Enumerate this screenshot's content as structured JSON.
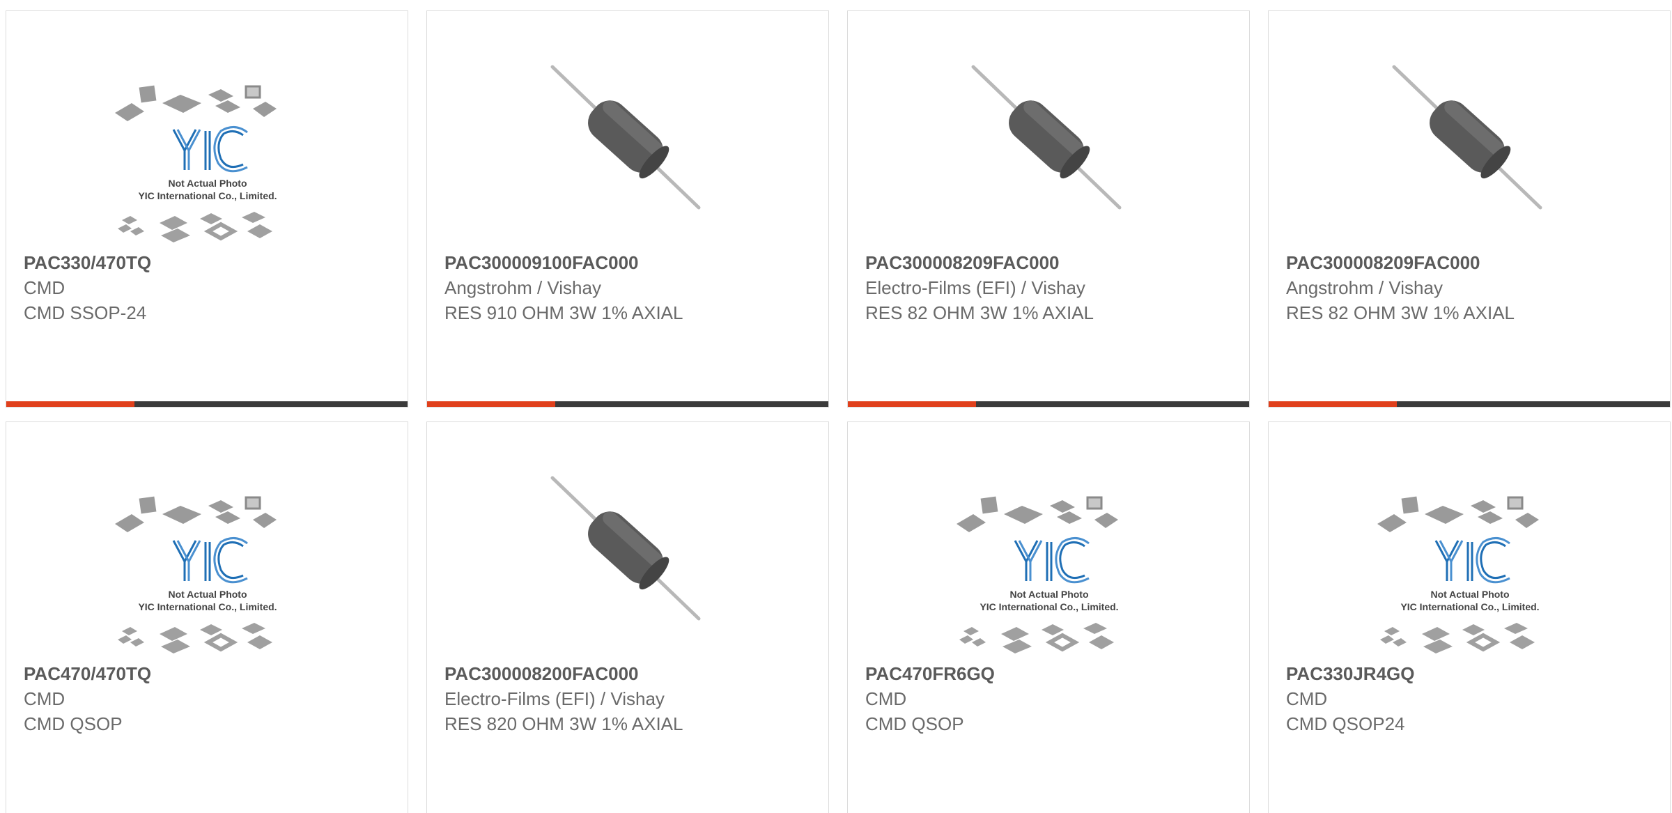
{
  "products": [
    {
      "part_number": "PAC330/470TQ",
      "manufacturer": "CMD",
      "description": "CMD SSOP-24",
      "image_type": "placeholder",
      "placeholder_line1": "Not Actual Photo",
      "placeholder_line2": "YIC International Co., Limited.",
      "logo_text": "YIC"
    },
    {
      "part_number": "PAC300009100FAC000",
      "manufacturer": "Angstrohm / Vishay",
      "description": "RES 910 OHM 3W 1% AXIAL",
      "image_type": "resistor"
    },
    {
      "part_number": "PAC300008209FAC000",
      "manufacturer": "Electro-Films (EFI) / Vishay",
      "description": "RES 82 OHM 3W 1% AXIAL",
      "image_type": "resistor"
    },
    {
      "part_number": "PAC300008209FAC000",
      "manufacturer": "Angstrohm / Vishay",
      "description": "RES 82 OHM 3W 1% AXIAL",
      "image_type": "resistor"
    },
    {
      "part_number": "PAC470/470TQ",
      "manufacturer": "CMD",
      "description": "CMD QSOP",
      "image_type": "placeholder",
      "placeholder_line1": "Not Actual Photo",
      "placeholder_line2": "YIC International Co., Limited.",
      "logo_text": "YIC"
    },
    {
      "part_number": "PAC300008200FAC000",
      "manufacturer": "Electro-Films (EFI) / Vishay",
      "description": "RES 820 OHM 3W 1% AXIAL",
      "image_type": "resistor"
    },
    {
      "part_number": "PAC470FR6GQ",
      "manufacturer": "CMD",
      "description": "CMD QSOP",
      "image_type": "placeholder",
      "placeholder_line1": "Not Actual Photo",
      "placeholder_line2": "YIC International Co., Limited.",
      "logo_text": "YIC"
    },
    {
      "part_number": "PAC330JR4GQ",
      "manufacturer": "CMD",
      "description": "CMD QSOP24",
      "image_type": "placeholder",
      "placeholder_line1": "Not Actual Photo",
      "placeholder_line2": "YIC International Co., Limited.",
      "logo_text": "YIC"
    }
  ],
  "colors": {
    "accent": "#e0401c",
    "bar": "#3b3b3b",
    "logo_blue": "#1f6fb5",
    "part_text": "#5a5a5a",
    "body_text": "#6a6a6a"
  }
}
